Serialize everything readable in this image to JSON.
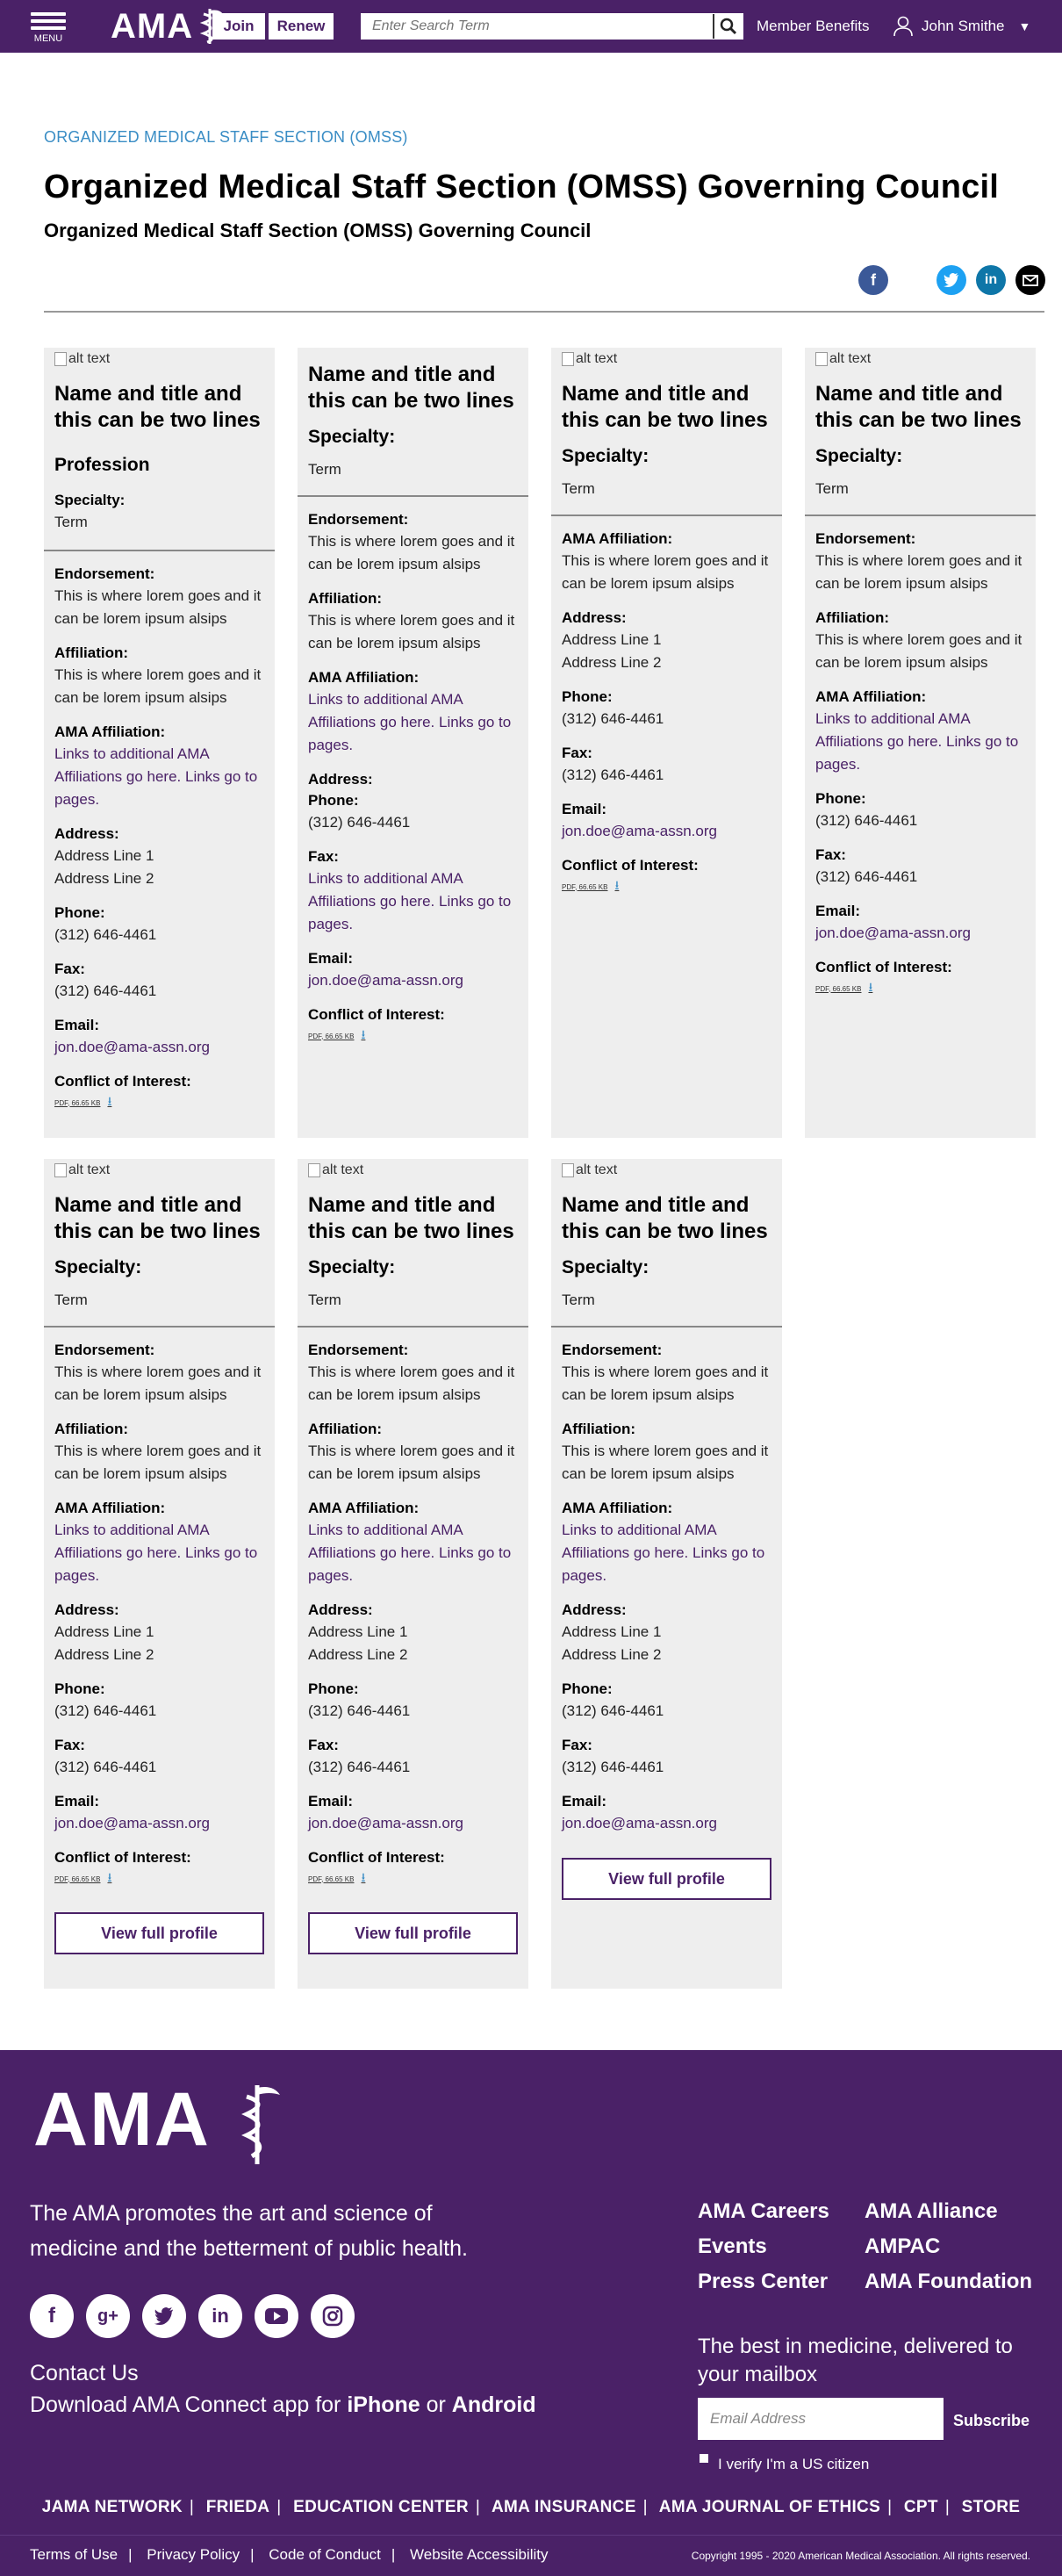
{
  "header": {
    "menu_label": "MENU",
    "logo_text": "AMA",
    "join_label": "Join",
    "renew_label": "Renew",
    "search_placeholder": "Enter Search Term",
    "member_benefits": "Member Benefits",
    "user_name": "John Smithe"
  },
  "page": {
    "breadcrumb": "ORGANIZED MEDICAL STAFF SECTION (OMSS)",
    "title": "Organized Medical Staff Section (OMSS) Governing Council",
    "subtitle": "Organized Medical Staff Section (OMSS) Governing Council"
  },
  "colors": {
    "brand": "#4a2167",
    "link": "#3a8dc5",
    "card_bg": "#eeeeee"
  },
  "share_icons": [
    "facebook-icon",
    "twitter-icon",
    "linkedin-icon",
    "email-icon"
  ],
  "common": {
    "alt_text": "alt text",
    "name": "Name and title and this can be two lines",
    "profession": "Profession",
    "specialty_label": "Specialty:",
    "term": "Term",
    "endorsement_label": "Endorsement:",
    "lorem": "This is where lorem goes and it can be lorem ipsum alsips",
    "affiliation_label": "Affiliation:",
    "ama_affiliation_label": "AMA Affiliation:",
    "ama_links": "Links to additional AMA Affiliations go here. Links go to pages.",
    "address_label": "Address:",
    "address_line1": "Address Line 1",
    "address_line2": "Address Line 2",
    "phone_label": "Phone:",
    "phone": "(312) 646-4461",
    "fax_label": "Fax:",
    "fax": "(312) 646-4461",
    "email_label": "Email:",
    "email": "jon.doe@ama-assn.org",
    "coi_label": "Conflict of Interest:",
    "pdf": "PDF, 66.65 KB",
    "fax_links": "Links to additional AMA Affiliations go here. Links go to pages.",
    "view_profile": "View full profile"
  },
  "footer": {
    "logo_text": "AMA",
    "tagline": "The AMA promotes the art and science of medicine and the betterment of public health.",
    "social": [
      "facebook-icon",
      "google-plus-icon",
      "twitter-icon",
      "linkedin-icon",
      "youtube-icon",
      "instagram-icon"
    ],
    "contact": "Contact Us",
    "app_prefix": "Download AMA Connect app for ",
    "app_ios": "iPhone",
    "app_or": " or ",
    "app_android": "Android",
    "col1": [
      "AMA Careers",
      "Events",
      "Press Center"
    ],
    "col2": [
      "AMA Alliance",
      "AMPAC",
      "AMA Foundation"
    ],
    "newsletter": "The best in medicine, delivered to your mailbox",
    "email_placeholder": "Email Address",
    "subscribe": "Subscribe",
    "verify": "I verify I'm a US citizen",
    "links": [
      "JAMA NETWORK",
      "FRIEDA",
      "EDUCATION CENTER",
      "AMA INSURANCE",
      "AMA JOURNAL OF ETHICS",
      "CPT",
      "STORE"
    ],
    "legal": [
      "Terms of Use",
      "Privacy Policy",
      "Code of Conduct",
      "Website Accessibility"
    ],
    "copyright": "Copyright 1995 - 2020 American Medical Association. All rights reserved."
  }
}
